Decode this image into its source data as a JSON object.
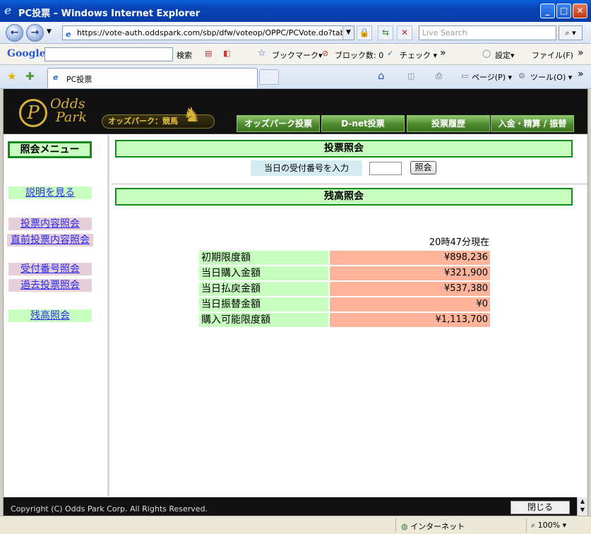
{
  "window": {
    "title": "PC投票 – Windows Internet Explorer",
    "minimize": "_",
    "maximize": "□",
    "close": "✕"
  },
  "browser": {
    "back": "←",
    "forward": "→",
    "address": "https://vote-auth.oddspark.com/sbp/dfw/voteop/OPPC/PCVote.do?tab=",
    "search_placeholder": "Live Search",
    "search_btn": "⌕ ▾",
    "google_logo": "Google",
    "google_search": "検索",
    "bookmarks": "ブックマーク▾",
    "blocked": "ブロック数: 0",
    "check": "チェック ▾",
    "more": "»",
    "settings": "設定▾",
    "file_menu": "ファイル(F)",
    "tab_title": "PC投票",
    "page_menu": "ページ(P) ▾",
    "tools_menu": "ツール(O) ▾"
  },
  "site": {
    "logo_letter": "P",
    "logo_line1": "Odds",
    "logo_line2": "Park",
    "brand_badge": "オッズパーク：競馬",
    "nav": [
      "オッズパーク投票",
      "D-net投票",
      "投票履歴",
      "入金・精算 / 振替"
    ]
  },
  "sidebar": {
    "title": "照会メニュー",
    "help": "説明を見る",
    "items": [
      "投票内容照会",
      "直前投票内容照会",
      "受付番号照会",
      "過去投票照会"
    ],
    "balance": "残高照会"
  },
  "vote_inquiry": {
    "heading": "投票照会",
    "input_label": "当日の受付番号を入力",
    "button": "照会"
  },
  "balance_inquiry": {
    "heading": "残高照会",
    "timestamp": "20時47分現在",
    "rows": [
      {
        "label": "初期限度額",
        "value": "¥898,236"
      },
      {
        "label": "当日購入金額",
        "value": "¥321,900"
      },
      {
        "label": "当日払戻金額",
        "value": "¥537,380"
      },
      {
        "label": "当日振替金額",
        "value": "¥0"
      },
      {
        "label": "購入可能限度額",
        "value": "¥1,113,700"
      }
    ]
  },
  "footer": {
    "copyright": "Copyright (C) Odds Park Corp. All Rights Reserved.",
    "close": "閉じる"
  },
  "status": {
    "zone": "インターネット",
    "zoom": "100% ▾"
  },
  "colors": {
    "menu_green": "#c8ffc0",
    "menu_border": "#14891c",
    "value_salmon": "#fdb49b",
    "brand_gold": "#d8b13a"
  }
}
